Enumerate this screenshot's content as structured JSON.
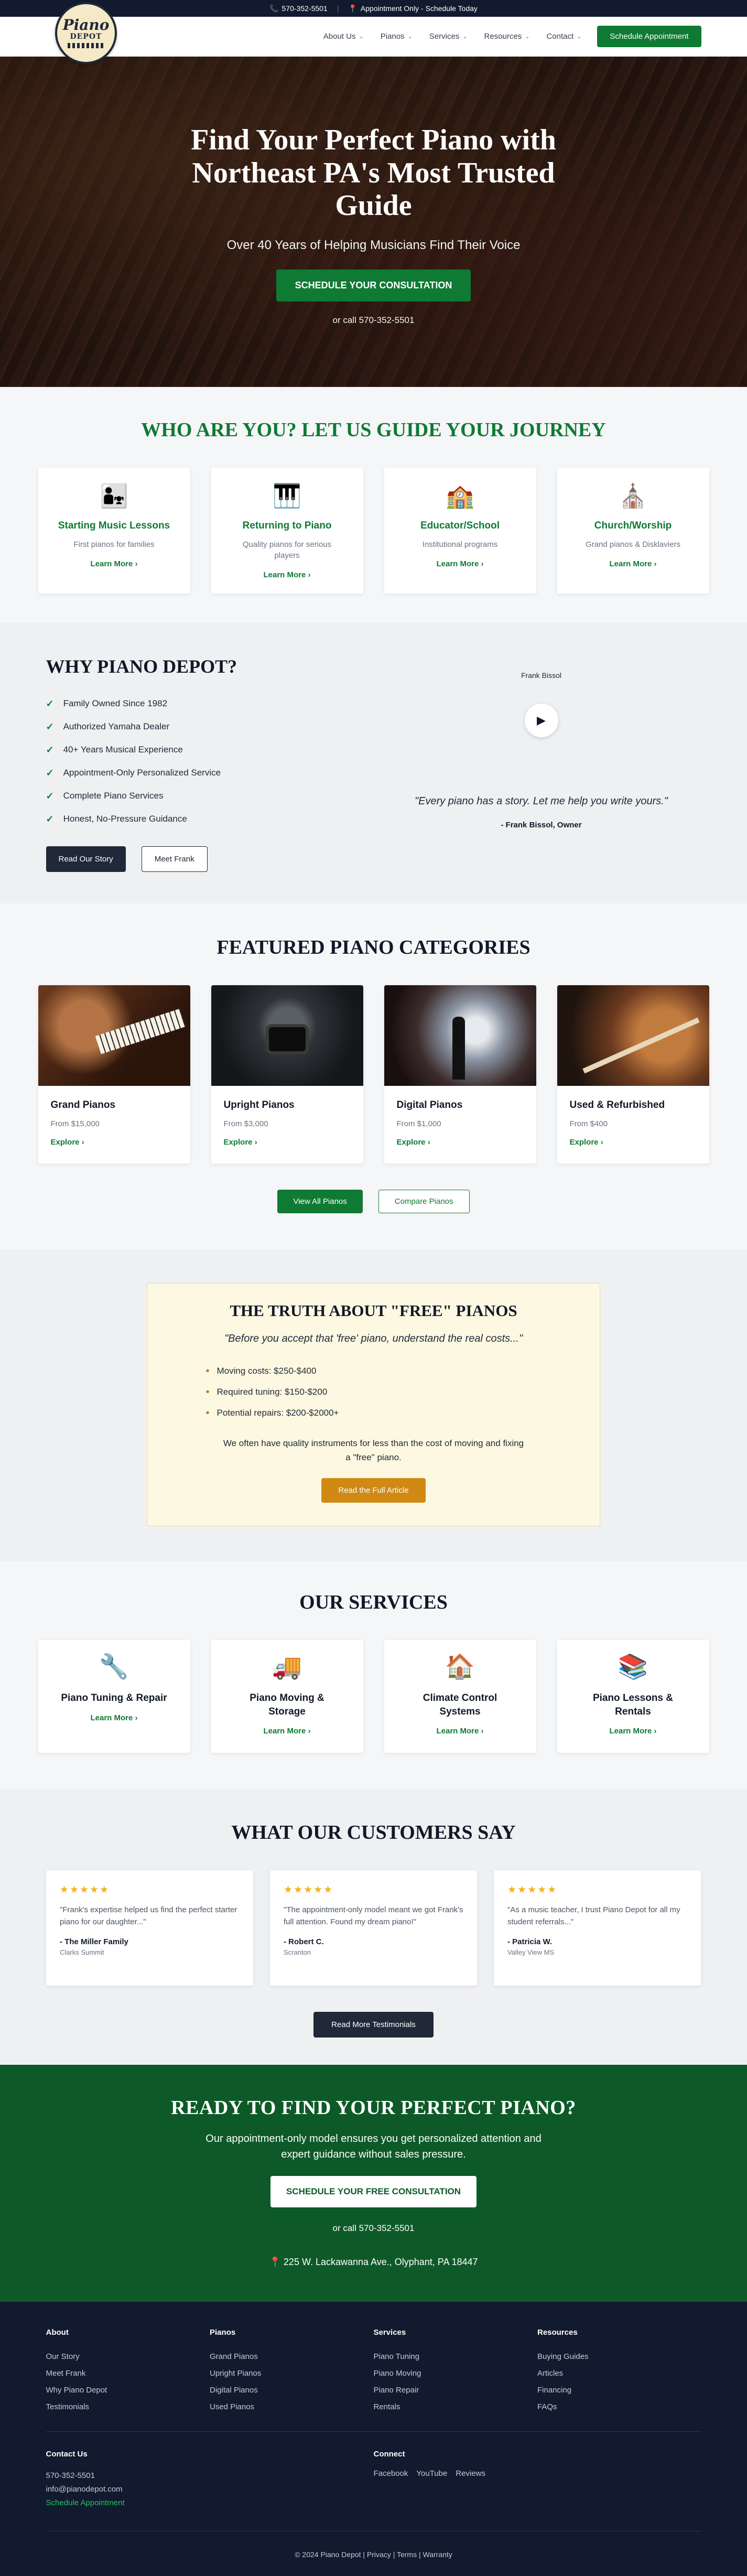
{
  "topbar": {
    "phone": "570-352-5501",
    "notice": "Appointment Only - Schedule Today"
  },
  "header": {
    "logo_line1": "Piano",
    "logo_line2": "DEPOT",
    "nav": [
      "About Us",
      "Pianos",
      "Services",
      "Resources",
      "Contact"
    ],
    "cta": "Schedule Appointment"
  },
  "hero": {
    "title": "Find Your Perfect Piano with Northeast PA's Most Trusted Guide",
    "subtitle": "Over 40 Years of Helping Musicians Find Their Voice",
    "cta": "SCHEDULE YOUR CONSULTATION",
    "call": "or call 570-352-5501"
  },
  "who": {
    "title": "WHO ARE YOU? LET US GUIDE YOUR JOURNEY",
    "cards": [
      {
        "icon": "people-icon",
        "glyph": "👨‍👧",
        "title": "Starting Music Lessons",
        "desc": "First pianos for families",
        "link": "Learn More"
      },
      {
        "icon": "piano-keys-icon",
        "glyph": "🎹",
        "title": "Returning to Piano",
        "desc": "Quality pianos for serious players",
        "link": "Learn More"
      },
      {
        "icon": "school-icon",
        "glyph": "🏫",
        "title": "Educator/School",
        "desc": "Institutional programs",
        "link": "Learn More"
      },
      {
        "icon": "church-icon",
        "glyph": "⛪",
        "title": "Church/Worship",
        "desc": "Grand pianos & Disklaviers",
        "link": "Learn More"
      }
    ]
  },
  "why": {
    "title": "WHY PIANO DEPOT?",
    "points": [
      "Family Owned Since 1982",
      "Authorized Yamaha Dealer",
      "40+ Years Musical Experience",
      "Appointment-Only Personalized Service",
      "Complete Piano Services",
      "Honest, No-Pressure Guidance"
    ],
    "btn_story": "Read Our Story",
    "btn_frank": "Meet Frank",
    "video_label": "Frank Bissol",
    "quote": "\"Every piano has a story. Let me help you write yours.\"",
    "quote_by": "- Frank Bissol, Owner"
  },
  "featured": {
    "title": "FEATURED PIANO CATEGORIES",
    "cards": [
      {
        "title": "Grand Pianos",
        "price": "From $15,000",
        "link": "Explore"
      },
      {
        "title": "Upright Pianos",
        "price": "From $3,000",
        "link": "Explore"
      },
      {
        "title": "Digital Pianos",
        "price": "From $1,000",
        "link": "Explore"
      },
      {
        "title": "Used & Refurbished",
        "price": "From $400",
        "link": "Explore"
      }
    ],
    "btn_all": "View All Pianos",
    "btn_compare": "Compare Pianos"
  },
  "truth": {
    "title": "THE TRUTH ABOUT \"FREE\" PIANOS",
    "quote": "\"Before you accept that 'free' piano, understand the real costs...\"",
    "items": [
      "Moving costs: $250-$400",
      "Required tuning: $150-$200",
      "Potential repairs: $200-$2000+"
    ],
    "para": "We often have quality instruments for less than the cost of moving and fixing a \"free\" piano.",
    "cta": "Read the Full Article"
  },
  "services": {
    "title": "OUR SERVICES",
    "cards": [
      {
        "icon": "wrench-icon",
        "glyph": "🔧",
        "title": "Piano Tuning & Repair",
        "link": "Learn More"
      },
      {
        "icon": "truck-icon",
        "glyph": "🚚",
        "title": "Piano Moving & Storage",
        "link": "Learn More"
      },
      {
        "icon": "house-icon",
        "glyph": "🏠",
        "title": "Climate Control Systems",
        "link": "Learn More"
      },
      {
        "icon": "books-icon",
        "glyph": "📚",
        "title": "Piano Lessons & Rentals",
        "link": "Learn More"
      }
    ]
  },
  "testimonials": {
    "title": "WHAT OUR CUSTOMERS SAY",
    "items": [
      {
        "stars": "★★★★★",
        "text": "\"Frank's expertise helped us find the perfect starter piano for our daughter...\"",
        "name": "- The Miller Family",
        "loc": "Clarks Summit"
      },
      {
        "stars": "★★★★★",
        "text": "\"The appointment-only model meant we got Frank's full attention. Found my dream piano!\"",
        "name": "- Robert C.",
        "loc": "Scranton"
      },
      {
        "stars": "★★★★★",
        "text": "\"As a music teacher, I trust Piano Depot for all my student referrals...\"",
        "name": "- Patricia W.",
        "loc": "Valley View MS"
      }
    ],
    "cta": "Read More Testimonials"
  },
  "cta": {
    "title": "READY TO FIND YOUR PERFECT PIANO?",
    "para": "Our appointment-only model ensures you get personalized attention and expert guidance without sales pressure.",
    "button": "SCHEDULE YOUR FREE CONSULTATION",
    "call": "or call 570-352-5501",
    "address": "225 W. Lackawanna Ave., Olyphant, PA 18447"
  },
  "footer": {
    "cols": [
      {
        "title": "About",
        "links": [
          "Our Story",
          "Meet Frank",
          "Why Piano Depot",
          "Testimonials"
        ]
      },
      {
        "title": "Pianos",
        "links": [
          "Grand Pianos",
          "Upright Pianos",
          "Digital Pianos",
          "Used Pianos"
        ]
      },
      {
        "title": "Services",
        "links": [
          "Piano Tuning",
          "Piano Moving",
          "Piano Repair",
          "Rentals"
        ]
      },
      {
        "title": "Resources",
        "links": [
          "Buying Guides",
          "Articles",
          "Financing",
          "FAQs"
        ]
      }
    ],
    "contact_title": "Contact Us",
    "contact_phone": "570-352-5501",
    "contact_email": "info@pianodepot.com",
    "contact_schedule": "Schedule Appointment",
    "connect_title": "Connect",
    "social": [
      "Facebook",
      "YouTube",
      "Reviews"
    ],
    "copyright": "© 2024 Piano Depot | Privacy | Terms | Warranty"
  },
  "colors": {
    "brand_green": "#0f7a33",
    "navy": "#111a2e",
    "gold": "#d08a14"
  }
}
